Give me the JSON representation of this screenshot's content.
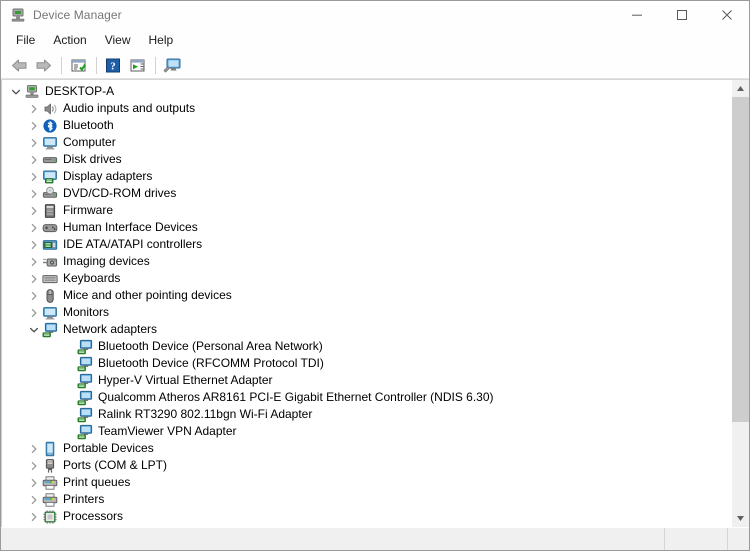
{
  "window": {
    "title": "Device Manager",
    "title_icon": "device-manager-icon",
    "controls": {
      "minimize": "minimize-icon",
      "maximize": "maximize-icon",
      "close": "close-icon"
    }
  },
  "menubar": {
    "items": [
      {
        "label": "File"
      },
      {
        "label": "Action"
      },
      {
        "label": "View"
      },
      {
        "label": "Help"
      }
    ]
  },
  "toolbar": {
    "buttons": [
      {
        "name": "back-arrow-icon",
        "tip": "Back"
      },
      {
        "name": "forward-arrow-icon",
        "tip": "Forward"
      },
      {
        "name": "properties-icon",
        "tip": "Properties"
      },
      {
        "name": "help-icon",
        "tip": "Help"
      },
      {
        "name": "show-hidden-devices-icon",
        "tip": "Show hidden devices"
      },
      {
        "name": "scan-hardware-changes-icon",
        "tip": "Scan for hardware changes"
      }
    ]
  },
  "tree": {
    "root": {
      "label": "DESKTOP-A",
      "icon": "computer-root-icon",
      "expanded": true
    },
    "nodes": [
      {
        "label": "Audio inputs and outputs",
        "icon": "speaker-icon",
        "level": 1,
        "expanded": false
      },
      {
        "label": "Bluetooth",
        "icon": "bluetooth-icon",
        "level": 1,
        "expanded": false
      },
      {
        "label": "Computer",
        "icon": "monitor-icon",
        "level": 1,
        "expanded": false
      },
      {
        "label": "Disk drives",
        "icon": "disk-drive-icon",
        "level": 1,
        "expanded": false
      },
      {
        "label": "Display adapters",
        "icon": "display-adapter-icon",
        "level": 1,
        "expanded": false
      },
      {
        "label": "DVD/CD-ROM drives",
        "icon": "dvd-drive-icon",
        "level": 1,
        "expanded": false
      },
      {
        "label": "Firmware",
        "icon": "firmware-icon",
        "level": 1,
        "expanded": false
      },
      {
        "label": "Human Interface Devices",
        "icon": "hid-icon",
        "level": 1,
        "expanded": false
      },
      {
        "label": "IDE ATA/ATAPI controllers",
        "icon": "ide-controller-icon",
        "level": 1,
        "expanded": false
      },
      {
        "label": "Imaging devices",
        "icon": "imaging-device-icon",
        "level": 1,
        "expanded": false
      },
      {
        "label": "Keyboards",
        "icon": "keyboard-icon",
        "level": 1,
        "expanded": false
      },
      {
        "label": "Mice and other pointing devices",
        "icon": "mouse-icon",
        "level": 1,
        "expanded": false
      },
      {
        "label": "Monitors",
        "icon": "monitor-icon",
        "level": 1,
        "expanded": false
      },
      {
        "label": "Network adapters",
        "icon": "network-adapter-icon",
        "level": 1,
        "expanded": true
      },
      {
        "label": "Bluetooth Device (Personal Area Network)",
        "icon": "network-adapter-icon",
        "level": 2,
        "expanded": null
      },
      {
        "label": "Bluetooth Device (RFCOMM Protocol TDI)",
        "icon": "network-adapter-icon",
        "level": 2,
        "expanded": null
      },
      {
        "label": "Hyper-V Virtual Ethernet Adapter",
        "icon": "network-adapter-icon",
        "level": 2,
        "expanded": null
      },
      {
        "label": "Qualcomm Atheros AR8161 PCI-E Gigabit Ethernet Controller (NDIS 6.30)",
        "icon": "network-adapter-icon",
        "level": 2,
        "expanded": null
      },
      {
        "label": "Ralink RT3290 802.11bgn Wi-Fi Adapter",
        "icon": "network-adapter-icon",
        "level": 2,
        "expanded": null
      },
      {
        "label": "TeamViewer VPN Adapter",
        "icon": "network-adapter-icon",
        "level": 2,
        "expanded": null
      },
      {
        "label": "Portable Devices",
        "icon": "portable-device-icon",
        "level": 1,
        "expanded": false
      },
      {
        "label": "Ports (COM & LPT)",
        "icon": "port-icon",
        "level": 1,
        "expanded": false
      },
      {
        "label": "Print queues",
        "icon": "printer-icon",
        "level": 1,
        "expanded": false
      },
      {
        "label": "Printers",
        "icon": "printer-icon",
        "level": 1,
        "expanded": false
      },
      {
        "label": "Processors",
        "icon": "processor-icon",
        "level": 1,
        "expanded": false
      }
    ]
  },
  "scrollbar": {
    "up_arrow": "scroll-up-icon",
    "down_arrow": "scroll-down-icon",
    "thumb_position": "top"
  },
  "statusbar": {
    "message": "",
    "segment2": "",
    "segment3": ""
  },
  "colors": {
    "titlebar_bg": "#fefefe",
    "window_bg": "#f0f0f0",
    "tree_bg": "#ffffff",
    "accent_blue": "#3f9fe0",
    "scrollbar_thumb": "#cdcdcd",
    "text": "#000000",
    "title_text": "#767676"
  }
}
